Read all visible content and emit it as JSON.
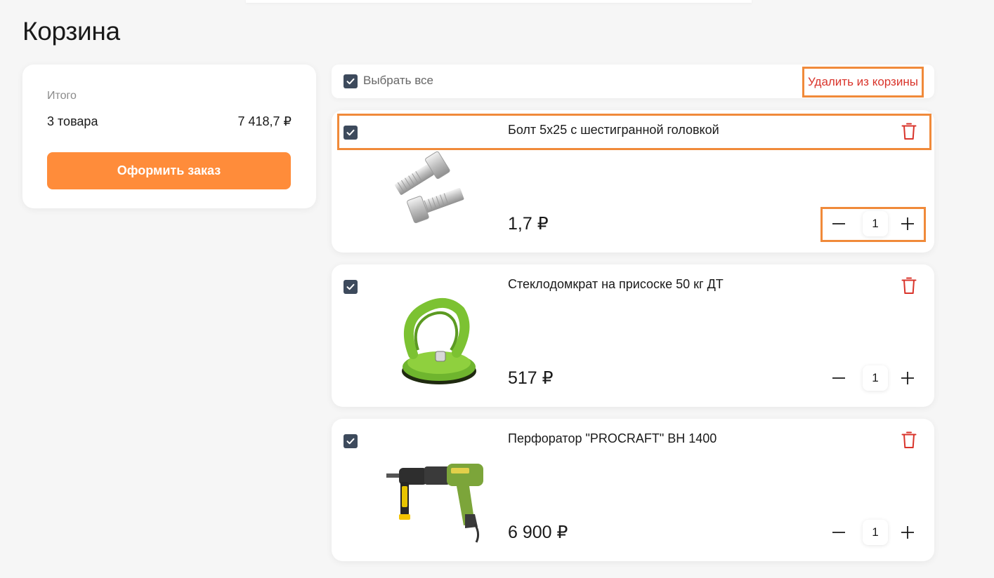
{
  "page": {
    "title": "Корзина"
  },
  "summary": {
    "label": "Итого",
    "count": "3 товара",
    "total": "7 418,7 ₽",
    "checkout_label": "Оформить заказ"
  },
  "select_all": {
    "label": "Выбрать все",
    "checked": true
  },
  "delete_selected_label": "Удалить из корзины",
  "items": [
    {
      "name": "Болт 5х25 с шестигранной головкой",
      "price": "1,7 ₽",
      "qty": "1",
      "checked": true,
      "image": "bolt"
    },
    {
      "name": "Стеклодомкрат на присоске 50 кг ДТ",
      "price": "517 ₽",
      "qty": "1",
      "checked": true,
      "image": "suction-cup"
    },
    {
      "name": "Перфоратор \"PROCRAFT\" BH 1400",
      "price": "6 900 ₽",
      "qty": "1",
      "checked": true,
      "image": "rotary-hammer"
    }
  ],
  "colors": {
    "accent": "#ff8c3a",
    "highlight": "#f08a3a",
    "danger": "#d9342b",
    "checkbox": "#3d4a5c"
  }
}
